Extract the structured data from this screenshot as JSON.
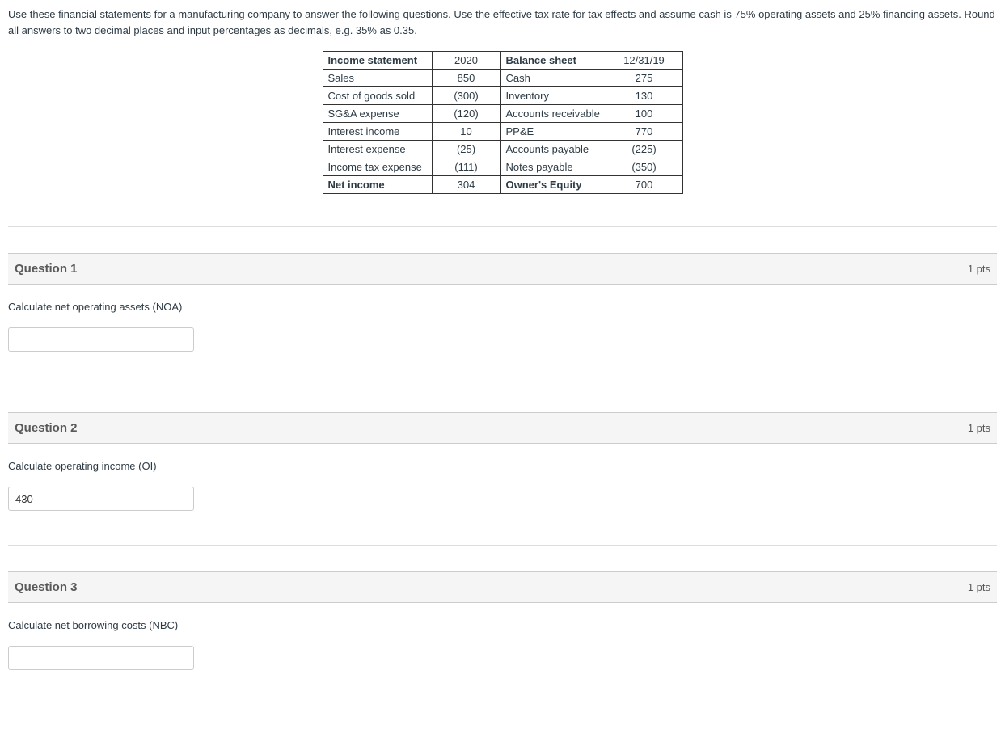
{
  "intro": {
    "text": "Use these financial statements for a manufacturing company to answer the following questions. Use the effective tax rate for tax effects and assume cash is 75% operating assets and 25% financing assets. Round all answers to two decimal places and input percentages as decimals, e.g. 35% as 0.35."
  },
  "table": {
    "income_header_label": "Income statement",
    "income_header_year": "2020",
    "balance_header_label": "Balance sheet",
    "balance_header_date": "12/31/19",
    "rows": [
      {
        "is_label": "Sales",
        "is_val": "850",
        "bs_label": "Cash",
        "bs_val": "275"
      },
      {
        "is_label": "Cost of goods sold",
        "is_val": "(300)",
        "bs_label": "Inventory",
        "bs_val": "130"
      },
      {
        "is_label": "SG&A expense",
        "is_val": "(120)",
        "bs_label": "Accounts receivable",
        "bs_val": "100"
      },
      {
        "is_label": "Interest income",
        "is_val": "10",
        "bs_label": "PP&E",
        "bs_val": "770"
      },
      {
        "is_label": "Interest expense",
        "is_val": "(25)",
        "bs_label": "Accounts payable",
        "bs_val": "(225)"
      },
      {
        "is_label": "Income tax expense",
        "is_val": "(111)",
        "bs_label": "Notes payable",
        "bs_val": "(350)"
      },
      {
        "is_label": "Net income",
        "is_val": "304",
        "bs_label": "Owner's Equity",
        "bs_val": "700",
        "bold": true
      }
    ]
  },
  "questions": [
    {
      "title": "Question 1",
      "pts": "1 pts",
      "prompt": "Calculate net operating assets (NOA)",
      "value": ""
    },
    {
      "title": "Question 2",
      "pts": "1 pts",
      "prompt": "Calculate operating income (OI)",
      "value": "430"
    },
    {
      "title": "Question 3",
      "pts": "1 pts",
      "prompt": "Calculate net borrowing costs (NBC)",
      "value": ""
    }
  ]
}
